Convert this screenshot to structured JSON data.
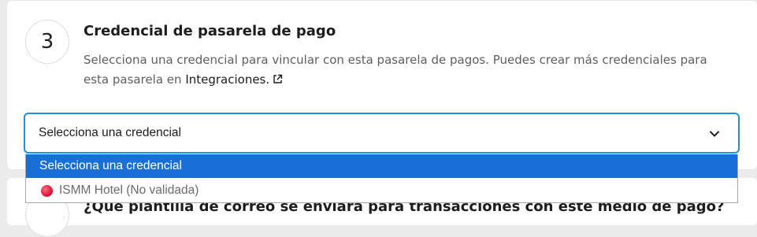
{
  "step": {
    "number": "3",
    "title": "Credencial de pasarela de pago",
    "description": "Selecciona una credencial para vincular con esta pasarela de pagos. Puedes crear más credenciales para esta pasarela en ",
    "link_label": "Integraciones.",
    "link_icon": "external-link-icon"
  },
  "select": {
    "value": "Selecciona una credencial",
    "icon": "chevron-down-icon",
    "options": [
      {
        "label": "Selecciona una credencial",
        "selected": true
      },
      {
        "label": "ISMM Hotel (No validada)",
        "status_color": "#e2143a",
        "selected": false
      }
    ]
  },
  "next_step": {
    "title": "¿Qué plantilla de correo se enviará para transacciones con este medio de pago?"
  },
  "colors": {
    "focus_border": "#1f8fe0",
    "selected_option_bg": "#1a6fd6",
    "status_invalid": "#e2143a"
  }
}
